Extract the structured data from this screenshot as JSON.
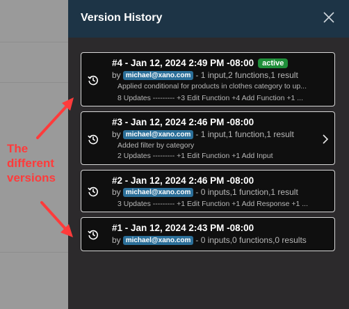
{
  "panel": {
    "title": "Version History"
  },
  "versions": [
    {
      "title": "#4 - Jan 12, 2024 2:49 PM -08:00",
      "badge": "active",
      "by": "by",
      "email": "michael@xano.com",
      "summary": "- 1 input,2 functions,1 result",
      "description": "Applied conditional for products in clothes category to up...",
      "updates": "8 Updates --------- +3 Edit Function +4 Add Function +1 ..."
    },
    {
      "title": "#3 - Jan 12, 2024 2:46 PM -08:00",
      "by": "by",
      "email": "michael@xano.com",
      "summary": "- 1 input,1 function,1 result",
      "description": "Added filter by category",
      "updates": "2 Updates --------- +1 Edit Function +1 Add Input"
    },
    {
      "title": "#2 - Jan 12, 2024 2:46 PM -08:00",
      "by": "by",
      "email": "michael@xano.com",
      "summary": "- 0 inputs,1 function,1 result",
      "updates": "3 Updates --------- +1 Edit Function +1 Add Response +1 ..."
    },
    {
      "title": "#1 - Jan 12, 2024 2:43 PM -08:00",
      "by": "by",
      "email": "michael@xano.com",
      "summary": "- 0 inputs,0 functions,0 results"
    }
  ],
  "annotation": {
    "line1": "The",
    "line2": "different",
    "line3": "versions"
  },
  "colors": {
    "header": "#1d3446",
    "panel": "#2c2a2c",
    "card": "#0f0f0f",
    "active_badge": "#1f8f3a",
    "email_pill": "#2b6f99",
    "annotation": "#ff3b3b"
  }
}
